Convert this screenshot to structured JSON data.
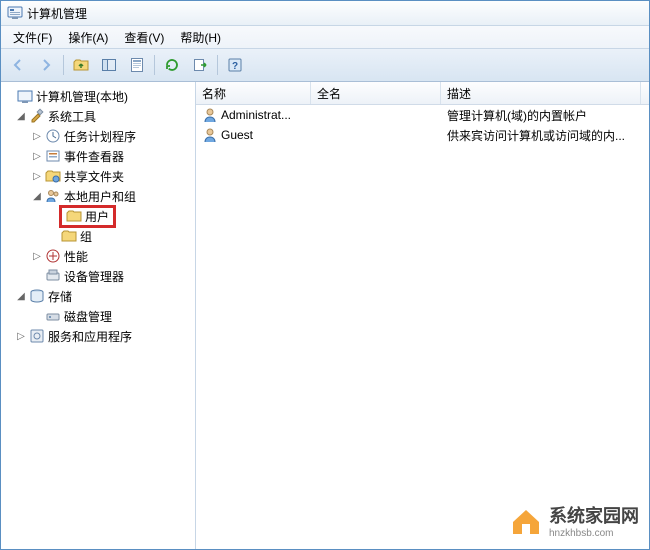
{
  "window": {
    "title": "计算机管理"
  },
  "menu": {
    "file": "文件(F)",
    "action": "操作(A)",
    "view": "查看(V)",
    "help": "帮助(H)"
  },
  "tree": {
    "root": "计算机管理(本地)",
    "system_tools": "系统工具",
    "task_scheduler": "任务计划程序",
    "event_viewer": "事件查看器",
    "shared_folders": "共享文件夹",
    "local_users_groups": "本地用户和组",
    "users": "用户",
    "groups": "组",
    "performance": "性能",
    "device_manager": "设备管理器",
    "storage": "存储",
    "disk_management": "磁盘管理",
    "services_apps": "服务和应用程序"
  },
  "columns": {
    "name": "名称",
    "full_name": "全名",
    "description": "描述"
  },
  "column_widths": {
    "name": 115,
    "full_name": 130,
    "description": 200
  },
  "users": [
    {
      "name": "Administrat...",
      "full_name": "",
      "description": "管理计算机(域)的内置帐户"
    },
    {
      "name": "Guest",
      "full_name": "",
      "description": "供来宾访问计算机或访问域的内..."
    }
  ],
  "watermark": {
    "text": "系统家园网",
    "url": "hnzkhbsb.com"
  },
  "colors": {
    "highlight": "#d42a2a",
    "chrome_border": "#5a8fc2"
  }
}
